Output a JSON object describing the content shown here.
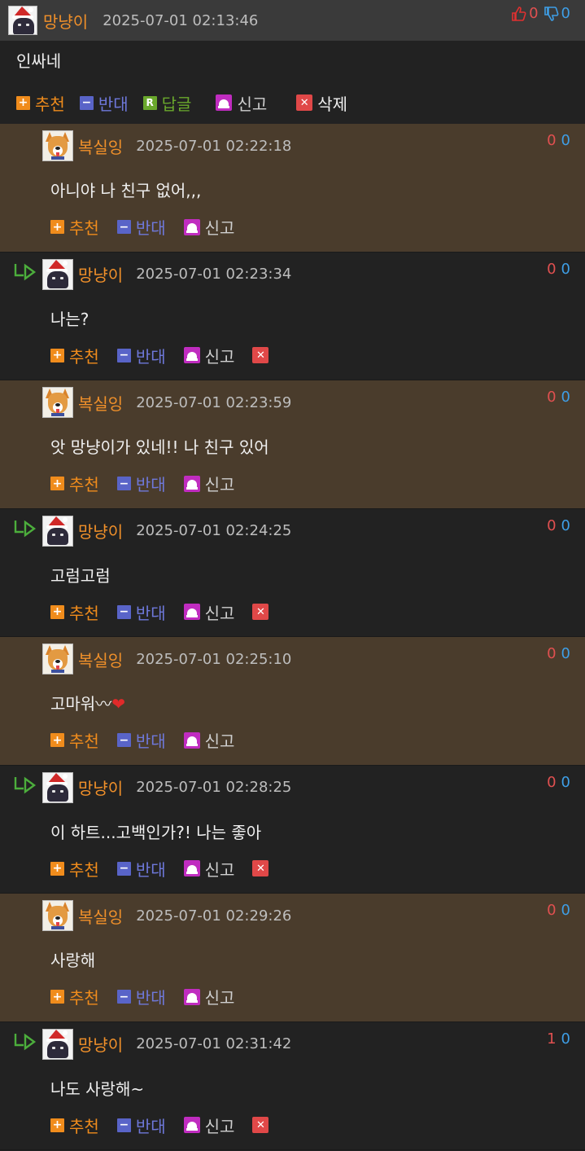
{
  "main_comment": {
    "nick": "망냥이",
    "time": "2025-07-01 02:13:46",
    "up": "0",
    "down": "0",
    "content": "인싸네",
    "actions": {
      "recommend": "추천",
      "oppose": "반대",
      "reply": "답글",
      "report": "신고",
      "delete": "삭제"
    }
  },
  "labels": {
    "recommend": "추천",
    "oppose": "반대",
    "report": "신고"
  },
  "replies": [
    {
      "nick": "복실잉",
      "time": "2025-07-01 02:22:18",
      "up": "0",
      "down": "0",
      "content": "아니야 나 친구 없어,,,"
    },
    {
      "nick": "망냥이",
      "time": "2025-07-01 02:23:34",
      "up": "0",
      "down": "0",
      "content": "나는?"
    },
    {
      "nick": "복실잉",
      "time": "2025-07-01 02:23:59",
      "up": "0",
      "down": "0",
      "content": "앗 망냥이가 있네!! 나 친구 있어"
    },
    {
      "nick": "망냥이",
      "time": "2025-07-01 02:24:25",
      "up": "0",
      "down": "0",
      "content": "고럼고럼"
    },
    {
      "nick": "복실잉",
      "time": "2025-07-01 02:25:10",
      "up": "0",
      "down": "0",
      "content": "고마워〰"
    },
    {
      "nick": "망냥이",
      "time": "2025-07-01 02:28:25",
      "up": "0",
      "down": "0",
      "content": "이 하트...고백인가?! 나는 좋아"
    },
    {
      "nick": "복실잉",
      "time": "2025-07-01 02:29:26",
      "up": "0",
      "down": "0",
      "content": "사랑해"
    },
    {
      "nick": "망냥이",
      "time": "2025-07-01 02:31:42",
      "up": "1",
      "down": "0",
      "content": "나도 사랑해~"
    }
  ],
  "heart_glyph": "❤",
  "colors": {
    "nick": "#f0902a",
    "recommend": "#f08c1c",
    "oppose": "#5964c8",
    "reply": "#6aa82c",
    "report": "#c02cc0",
    "delete": "#e04848",
    "reply_bg_alt": "#4a3c2c",
    "bg": "#222222"
  }
}
